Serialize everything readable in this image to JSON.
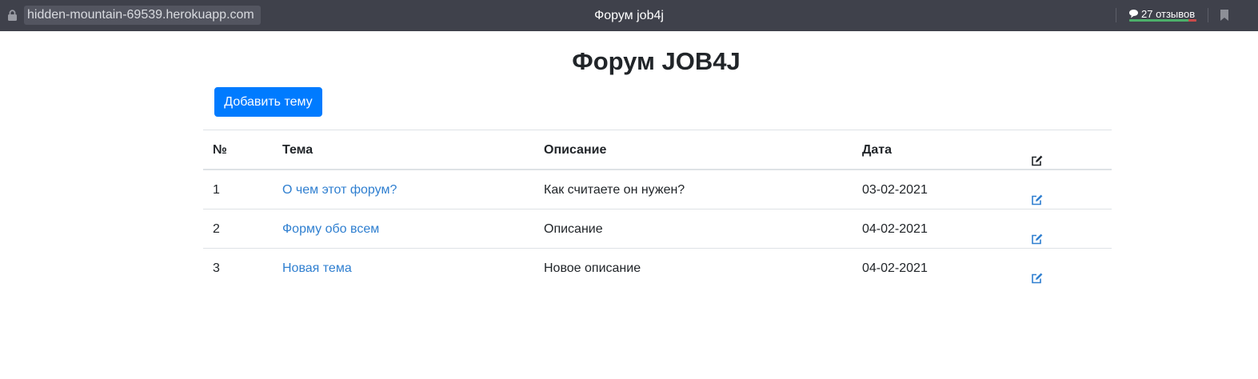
{
  "browser": {
    "url": "hidden-mountain-69539.herokuapp.com",
    "page_title": "Форум job4j",
    "reviews_label": "27 отзывов",
    "icons": {
      "lock": "lock-icon",
      "reviews": "speech-bubble-icon",
      "bookmark": "bookmark-icon"
    }
  },
  "page": {
    "heading": "Форум JOB4J",
    "add_button_label": "Добавить тему",
    "accent_color": "#007bff",
    "link_color": "#2f7fd0"
  },
  "table": {
    "headers": {
      "num": "№",
      "topic": "Тема",
      "description": "Описание",
      "date": "Дата",
      "edit_icon": "edit-icon"
    },
    "rows": [
      {
        "num": "1",
        "topic": "О чем этот форум?",
        "description": "Как считаете он нужен?",
        "date": "03-02-2021"
      },
      {
        "num": "2",
        "topic": "Форму обо всем",
        "description": "Описание",
        "date": "04-02-2021"
      },
      {
        "num": "3",
        "topic": "Новая тема",
        "description": "Новое описание",
        "date": "04-02-2021"
      }
    ]
  }
}
